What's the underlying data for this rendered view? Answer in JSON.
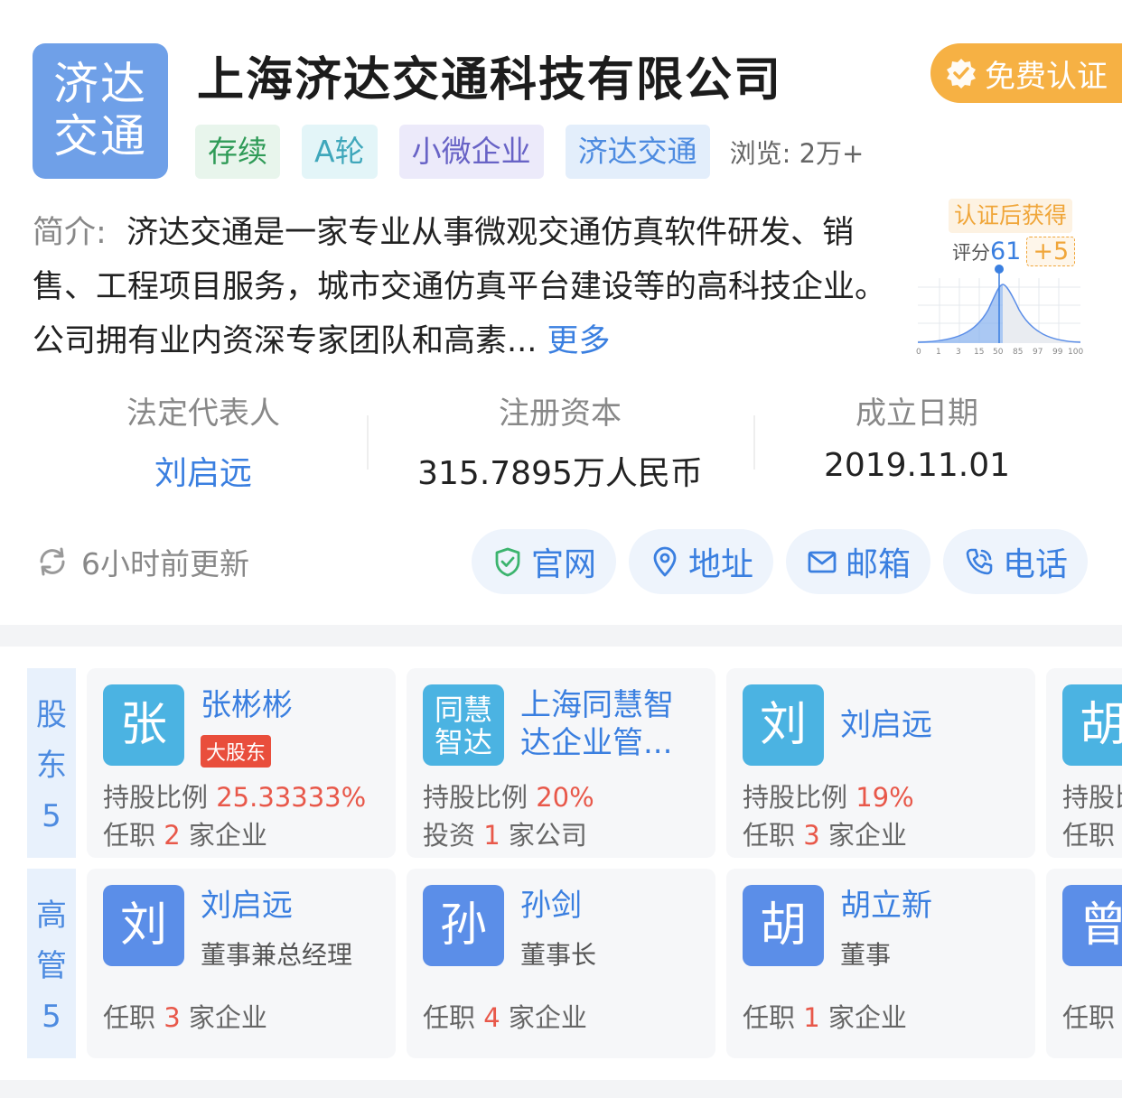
{
  "company": {
    "logo_text": "济达\n交通",
    "name": "上海济达交通科技有限公司",
    "certify_label": "免费认证",
    "tags": [
      "存续",
      "A轮",
      "小微企业",
      "济达交通"
    ],
    "views": "浏览: 2万+",
    "intro_label": "简介:",
    "intro_text": "济达交通是一家专业从事微观交通仿真软件研发、销售、工程项目服务，城市交通仿真平台建设等的高科技企业。公司拥有业内资深专家团队和高素...",
    "intro_more": "更多"
  },
  "score": {
    "tip": "认证后获得",
    "label": "评分",
    "value": "61",
    "plus": "+5",
    "ticks": [
      "0",
      "1",
      "3",
      "15",
      "50",
      "85",
      "97",
      "99",
      "100"
    ]
  },
  "info": {
    "legal_rep_label": "法定代表人",
    "legal_rep_value": "刘启远",
    "capital_label": "注册资本",
    "capital_value": "315.7895万人民币",
    "founded_label": "成立日期",
    "founded_value": "2019.11.01"
  },
  "updated": "6小时前更新",
  "actions": {
    "website": "官网",
    "address": "地址",
    "email": "邮箱",
    "phone": "电话"
  },
  "shareholders": {
    "label_lines": [
      "股",
      "东",
      "5"
    ],
    "cards": [
      {
        "avatar": "张",
        "name": "张彬彬",
        "badge": "大股东",
        "ratio_label": "持股比例",
        "ratio": "25.33333%",
        "l2_pre": "任职",
        "l2_num": "2",
        "l2_post": "家企业"
      },
      {
        "avatar": "同慧\n智达",
        "name": "上海同慧智达企业管...",
        "ratio_label": "持股比例",
        "ratio": "20%",
        "l2_pre": "投资",
        "l2_num": "1",
        "l2_post": "家公司"
      },
      {
        "avatar": "刘",
        "name": "刘启远",
        "ratio_label": "持股比例",
        "ratio": "19%",
        "l2_pre": "任职",
        "l2_num": "3",
        "l2_post": "家企业"
      },
      {
        "avatar": "胡",
        "name": "",
        "ratio_label": "持股比例",
        "ratio": "",
        "l2_pre": "任职",
        "l2_num": "",
        "l2_post": ""
      }
    ]
  },
  "executives": {
    "label_lines": [
      "高",
      "管",
      "5"
    ],
    "cards": [
      {
        "avatar": "刘",
        "name": "刘启远",
        "role": "董事兼总经理",
        "l_pre": "任职",
        "l_num": "3",
        "l_post": "家企业"
      },
      {
        "avatar": "孙",
        "name": "孙剑",
        "role": "董事长",
        "l_pre": "任职",
        "l_num": "4",
        "l_post": "家企业"
      },
      {
        "avatar": "胡",
        "name": "胡立新",
        "role": "董事",
        "l_pre": "任职",
        "l_num": "1",
        "l_post": "家企业"
      },
      {
        "avatar": "曾",
        "name": "",
        "role": "",
        "l_pre": "任职",
        "l_num": "",
        "l_post": ""
      }
    ]
  },
  "colors": {
    "accent": "#3a7fe0",
    "certify": "#f6b144",
    "red": "#e8584a",
    "avatar_cyan": "#4bb3e2",
    "avatar_blue": "#5b8ee8"
  }
}
